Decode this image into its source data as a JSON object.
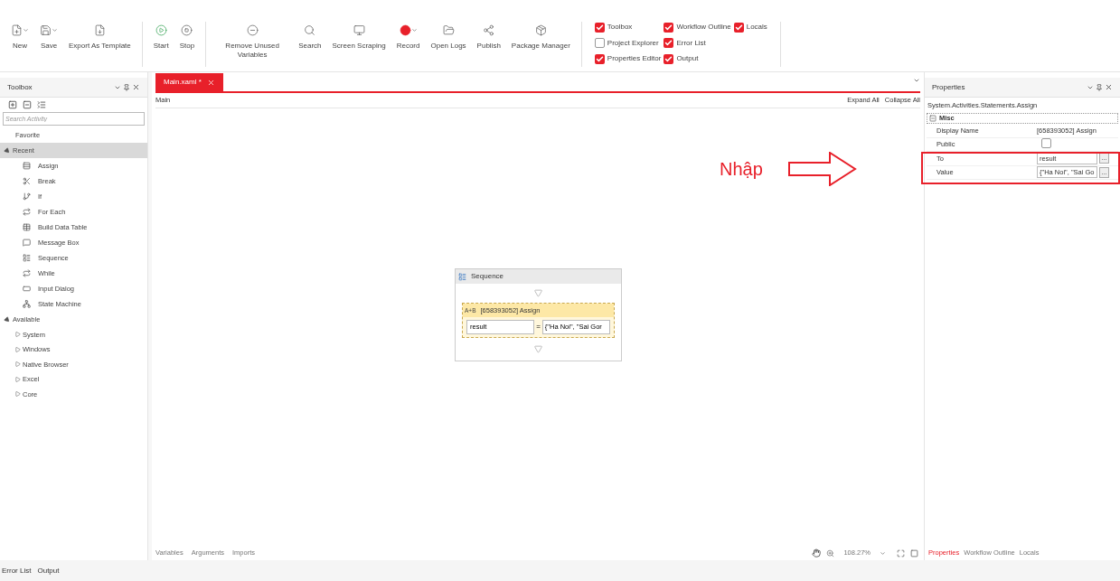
{
  "toolbar": {
    "groups": [
      {
        "buttons": [
          {
            "label": "New",
            "menu": true
          },
          {
            "label": "Save",
            "menu": true
          },
          {
            "label": "Export As Template",
            "menu": false
          }
        ]
      },
      {
        "buttons": [
          {
            "label": "Start",
            "menu": false
          },
          {
            "label": "Stop",
            "menu": false
          }
        ]
      },
      {
        "buttons": [
          {
            "label": "Remove Unused Variables",
            "menu": false
          },
          {
            "label": "Search",
            "menu": false
          },
          {
            "label": "Screen Scraping",
            "menu": false
          },
          {
            "label": "Record",
            "menu": true
          },
          {
            "label": "Open Logs",
            "menu": false
          },
          {
            "label": "Publish",
            "menu": false
          },
          {
            "label": "Package Manager",
            "menu": false
          }
        ]
      }
    ],
    "panel_toggles": [
      {
        "label": "Toolbox",
        "checked": true
      },
      {
        "label": "Project Explorer",
        "checked": false
      },
      {
        "label": "Properties Editor",
        "checked": true
      },
      {
        "label": "Workflow Outline",
        "checked": true
      },
      {
        "label": "Error List",
        "checked": true
      },
      {
        "label": "Output",
        "checked": true
      },
      {
        "label": "Locals",
        "checked": true
      }
    ]
  },
  "toolbox": {
    "title": "Toolbox",
    "search": {
      "placeholder": "Search Activity"
    },
    "items": [
      {
        "label": "Favorite",
        "selected": false
      },
      {
        "label": "Recent",
        "selected": true,
        "expanded": true,
        "children": [
          {
            "label": "Assign"
          },
          {
            "label": "Break"
          },
          {
            "label": "If"
          },
          {
            "label": "For Each"
          },
          {
            "label": "Build Data Table"
          },
          {
            "label": "Message Box"
          },
          {
            "label": "Sequence"
          },
          {
            "label": "While"
          },
          {
            "label": "Input Dialog"
          },
          {
            "label": "State Machine"
          }
        ]
      },
      {
        "label": "Available",
        "selected": false,
        "expanded": true,
        "children": [
          {
            "label": "System",
            "expanded": false
          },
          {
            "label": "Windows",
            "expanded": false
          },
          {
            "label": "Native Browser",
            "expanded": false
          },
          {
            "label": "Excel",
            "expanded": false
          },
          {
            "label": "Core",
            "expanded": false
          }
        ]
      }
    ]
  },
  "designer": {
    "tabs": [
      {
        "label": "Main.xaml *",
        "selected": true
      }
    ],
    "breadcrumb": "Main",
    "expand_all": "Expand All",
    "collapse_all": "Collapse All",
    "sequence": {
      "title": "Sequence",
      "assign": {
        "badge": "A+B",
        "title": "[658393052] Assign",
        "to": "result",
        "equals": "=",
        "value": "{\"Ha Noi\", \"Sai Gor"
      }
    },
    "bottom_tabs": [
      "Variables",
      "Arguments",
      "Imports"
    ],
    "zoom": "108.27%"
  },
  "annotation": {
    "text": "Nhập"
  },
  "properties": {
    "title": "Properties",
    "type_name": "System.Activities.Statements.Assign",
    "category": "Misc",
    "rows": [
      {
        "kind": "text",
        "label": "Display Name",
        "value": "[658393052] Assign"
      },
      {
        "kind": "checkbox",
        "label": "Public",
        "checked": false
      },
      {
        "kind": "field",
        "label": "To",
        "value": "result",
        "button": "..."
      },
      {
        "kind": "field",
        "label": "Value",
        "value": "{\"Ha Noi\", \"Sai Go",
        "button": "..."
      }
    ],
    "tabs": [
      {
        "label": "Properties",
        "selected": true
      },
      {
        "label": "Workflow Outline",
        "selected": false
      },
      {
        "label": "Locals",
        "selected": false
      }
    ]
  },
  "status_bar": {
    "tabs": [
      "Error List",
      "Output"
    ]
  }
}
